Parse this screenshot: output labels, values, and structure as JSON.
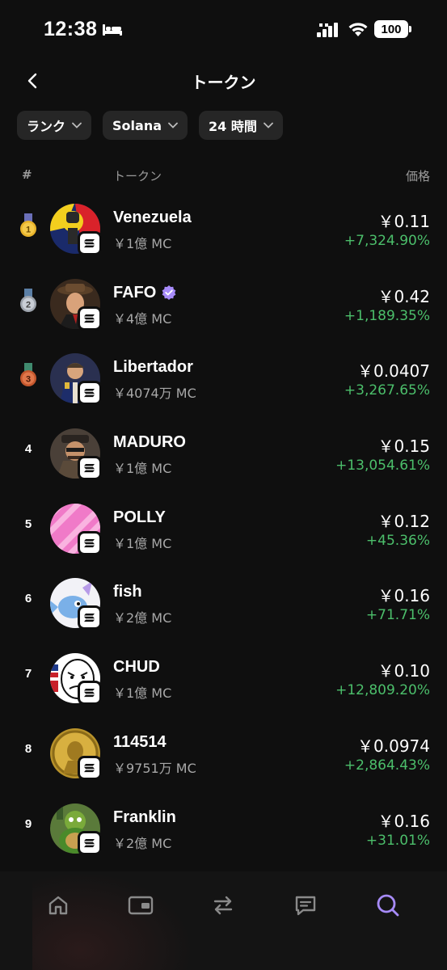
{
  "status_bar": {
    "time": "12:38",
    "battery": "100"
  },
  "header": {
    "title": "トークン"
  },
  "filters": [
    {
      "label": "ランク"
    },
    {
      "label": "Solana"
    },
    {
      "label": "24 時間"
    }
  ],
  "table_header": {
    "rank": "#",
    "token": "トークン",
    "price": "価格"
  },
  "tokens": [
    {
      "rank": "1",
      "name": "Venezuela",
      "mc": "￥1億 MC",
      "price": "￥0.11",
      "change": "+7,324.90%"
    },
    {
      "rank": "2",
      "name": "FAFO",
      "mc": "￥4億 MC",
      "price": "￥0.42",
      "change": "+1,189.35%"
    },
    {
      "rank": "3",
      "name": "Libertador",
      "mc": "￥4074万 MC",
      "price": "￥0.0407",
      "change": "+3,267.65%"
    },
    {
      "rank": "4",
      "name": "MADURO",
      "mc": "￥1億 MC",
      "price": "￥0.15",
      "change": "+13,054.61%"
    },
    {
      "rank": "5",
      "name": "POLLY",
      "mc": "￥1億 MC",
      "price": "￥0.12",
      "change": "+45.36%"
    },
    {
      "rank": "6",
      "name": "fish",
      "mc": "￥2億 MC",
      "price": "￥0.16",
      "change": "+71.71%"
    },
    {
      "rank": "7",
      "name": "CHUD",
      "mc": "￥1億 MC",
      "price": "￥0.10",
      "change": "+12,809.20%"
    },
    {
      "rank": "8",
      "name": "114514",
      "mc": "￥9751万 MC",
      "price": "￥0.0974",
      "change": "+2,864.43%"
    },
    {
      "rank": "9",
      "name": "Franklin",
      "mc": "￥2億 MC",
      "price": "￥0.16",
      "change": "+31.01%"
    }
  ],
  "colors": {
    "positive": "#4cbf6b",
    "accent": "#a78bfa",
    "gold": "#e8b32a",
    "silver": "#b9bec6",
    "bronze": "#d9683a"
  },
  "icons": [
    "back-icon",
    "chevron-down-icon",
    "home-icon",
    "wallet-icon",
    "swap-icon",
    "chat-icon",
    "search-icon",
    "solana-icon",
    "verified-icon"
  ]
}
